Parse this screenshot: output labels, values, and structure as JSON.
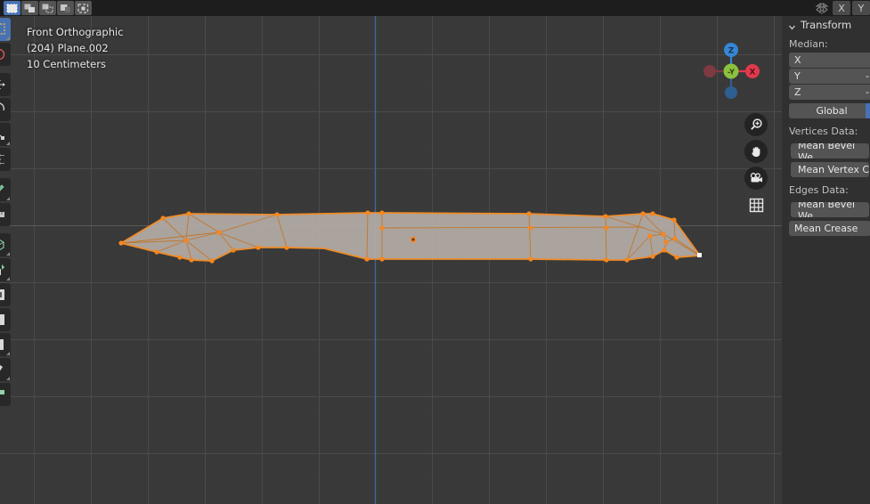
{
  "header": {
    "select_modes": [
      {
        "name": "set-select-mode",
        "label": "Set",
        "active": true
      },
      {
        "name": "extend-select-mode",
        "label": "Extend",
        "active": false
      },
      {
        "name": "subtract-select-mode",
        "label": "Subtract",
        "active": false
      },
      {
        "name": "invert-select-mode",
        "label": "Invert",
        "active": false
      },
      {
        "name": "intersect-select-mode",
        "label": "Intersect",
        "active": false
      }
    ],
    "mirror_icon": "mirror-icon",
    "axis_buttons": [
      {
        "label": "X"
      },
      {
        "label": "Y"
      }
    ]
  },
  "viewport": {
    "view_name": "Front Orthographic",
    "object_info": "(204) Plane.002",
    "grid_scale": "10 Centimeters",
    "background": "#393939",
    "grid_color": "#4b4b4b",
    "axis_line_color": "#4a5c74",
    "z_axis_color": "#4772b3",
    "mesh_face_color": "#b5aca6",
    "mesh_edge_color": "#ef8b27",
    "vertex_color": "#f5871f"
  },
  "gizmo": {
    "axes": [
      {
        "name": "z-axis-positive",
        "label": "Z",
        "color": "#3686d4"
      },
      {
        "name": "y-axis-negative",
        "label": "-Y",
        "color": "#8bc13e"
      },
      {
        "name": "x-axis-positive",
        "label": "X",
        "color": "#e03a4c"
      },
      {
        "name": "x-axis-negative",
        "label": "",
        "color": "#7e3a42"
      },
      {
        "name": "z-axis-negative",
        "label": "",
        "color": "#2e5f91"
      }
    ]
  },
  "nav_buttons": [
    {
      "name": "zoom-button",
      "icon": "magnifier-plus-icon"
    },
    {
      "name": "pan-button",
      "icon": "hand-icon"
    },
    {
      "name": "camera-view-button",
      "icon": "camera-icon"
    },
    {
      "name": "toggle-orthographic-button",
      "icon": "grid-icon"
    }
  ],
  "toolbar": {
    "tools": [
      {
        "name": "tweak-tool",
        "icon": "cursor-select-box-icon",
        "active": true,
        "has_submenu": true
      },
      {
        "name": "cursor-tool",
        "icon": "cursor-3d-icon",
        "active": false,
        "has_submenu": false
      },
      {
        "name": "move-tool",
        "icon": "move-arrows-icon",
        "active": false,
        "has_submenu": false
      },
      {
        "name": "rotate-tool",
        "icon": "rotate-icon",
        "active": false,
        "has_submenu": false
      },
      {
        "name": "scale-tool",
        "icon": "scale-icon",
        "active": false,
        "has_submenu": true
      },
      {
        "name": "transform-tool",
        "icon": "transform-icon",
        "active": false,
        "has_submenu": false
      },
      {
        "name": "annotate-tool",
        "icon": "pencil-icon",
        "active": false,
        "has_submenu": true
      },
      {
        "name": "measure-tool",
        "icon": "ruler-icon",
        "active": false,
        "has_submenu": false
      },
      {
        "name": "add-cube-tool",
        "icon": "cube-add-icon",
        "active": false,
        "has_submenu": true
      },
      {
        "name": "extrude-region-tool",
        "icon": "extrude-icon",
        "active": false,
        "has_submenu": true
      },
      {
        "name": "inset-faces-tool",
        "icon": "inset-faces-icon",
        "active": false,
        "has_submenu": false
      },
      {
        "name": "bevel-tool",
        "icon": "bevel-icon",
        "active": false,
        "has_submenu": false
      },
      {
        "name": "loop-cut-tool",
        "icon": "loop-cut-icon",
        "active": false,
        "has_submenu": true
      },
      {
        "name": "knife-tool",
        "icon": "knife-icon",
        "active": false,
        "has_submenu": true
      },
      {
        "name": "poly-build-tool",
        "icon": "poly-build-icon",
        "active": false,
        "has_submenu": false
      }
    ]
  },
  "sidebar": {
    "panel_title": "Transform",
    "median_label": "Median:",
    "median_fields": [
      {
        "label": "X",
        "value": ""
      },
      {
        "label": "Y",
        "value": "-"
      },
      {
        "label": "Z",
        "value": "-"
      }
    ],
    "global_button": "Global",
    "vertices_data_label": "Vertices Data:",
    "vertices_fields": [
      {
        "label": "Mean Bevel We"
      },
      {
        "label": "Mean Vertex C"
      }
    ],
    "edges_data_label": "Edges Data:",
    "edges_fields": [
      {
        "label": "Mean Bevel We"
      },
      {
        "label": "Mean Crease"
      }
    ]
  },
  "mesh": {
    "description": "sword-blade-mesh-edit-mode",
    "outline": [
      [
        136,
        273
      ],
      [
        183,
        245
      ],
      [
        212,
        240
      ],
      [
        311,
        241
      ],
      [
        312,
        240
      ],
      [
        413,
        239
      ],
      [
        429,
        239
      ],
      [
        594,
        240
      ],
      [
        680,
        243
      ],
      [
        722,
        240
      ],
      [
        733,
        240
      ],
      [
        757,
        247
      ],
      [
        786,
        287
      ],
      [
        760,
        289
      ],
      [
        746,
        281
      ],
      [
        733,
        288
      ],
      [
        704,
        292
      ],
      [
        681,
        292
      ],
      [
        596,
        291
      ],
      [
        429,
        291
      ],
      [
        412,
        291
      ],
      [
        364,
        279
      ],
      [
        322,
        278
      ],
      [
        290,
        278
      ],
      [
        262,
        281
      ],
      [
        238,
        293
      ],
      [
        215,
        292
      ],
      [
        202,
        289
      ],
      [
        176,
        283
      ]
    ],
    "vertices": [
      [
        136,
        273
      ],
      [
        183,
        245
      ],
      [
        212,
        240
      ],
      [
        209,
        270
      ],
      [
        238,
        293
      ],
      [
        215,
        292
      ],
      [
        202,
        289
      ],
      [
        176,
        283
      ],
      [
        246,
        261
      ],
      [
        248,
        259
      ],
      [
        311,
        241
      ],
      [
        322,
        278
      ],
      [
        290,
        278
      ],
      [
        262,
        281
      ],
      [
        413,
        239
      ],
      [
        429,
        239
      ],
      [
        412,
        291
      ],
      [
        429,
        291
      ],
      [
        594,
        240
      ],
      [
        596,
        291
      ],
      [
        680,
        243
      ],
      [
        681,
        292
      ],
      [
        722,
        240
      ],
      [
        733,
        240
      ],
      [
        757,
        247
      ],
      [
        760,
        289
      ],
      [
        746,
        281
      ],
      [
        733,
        288
      ],
      [
        704,
        292
      ],
      [
        745,
        263
      ],
      [
        758,
        268
      ],
      [
        748,
        272
      ],
      [
        730,
        265
      ],
      [
        786,
        287
      ]
    ]
  }
}
